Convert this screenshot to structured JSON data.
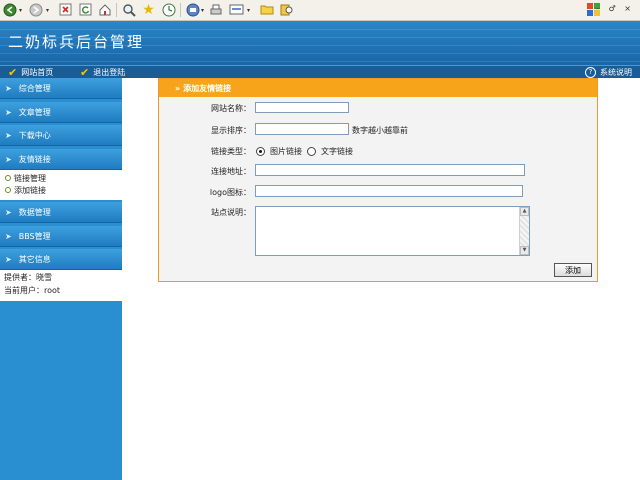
{
  "site_title": "二奶标兵后台管理",
  "nav": {
    "home": "网站首页",
    "logout": "退出登陆",
    "help": "系统说明"
  },
  "sidebar": {
    "items": [
      {
        "label": "综合管理"
      },
      {
        "label": "文章管理"
      },
      {
        "label": "下载中心"
      },
      {
        "label": "友情链接"
      },
      {
        "label": "数据管理"
      },
      {
        "label": "BBS管理"
      },
      {
        "label": "其它信息"
      }
    ],
    "links_sub": [
      "链接管理",
      "添加链接"
    ],
    "info": {
      "provider": "提供者：晓雪",
      "current_user": "当前用户：root"
    }
  },
  "form": {
    "header": "添加友情链接",
    "fields": {
      "site_name": {
        "label": "网站名称：",
        "value": ""
      },
      "order": {
        "label": "显示排序：",
        "value": "",
        "hint": "数字越小越靠前"
      },
      "link_type": {
        "label": "链接类型：",
        "options": [
          "图片链接",
          "文字链接"
        ],
        "selected": "图片链接"
      },
      "url": {
        "label": "连接地址：",
        "value": ""
      },
      "logo": {
        "label": "logo图标：",
        "value": ""
      },
      "description": {
        "label": "站点说明：",
        "value": ""
      }
    },
    "submit_label": "添加"
  },
  "colors": {
    "banner": "#1e74b7",
    "sidebar": "#2a8fd0",
    "panel_header": "#f7a41a",
    "panel_border": "#f29a1f"
  }
}
